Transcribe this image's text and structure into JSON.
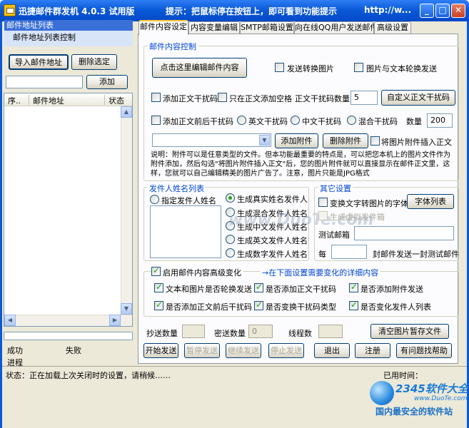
{
  "window": {
    "title": "迅捷邮件群发机 4.0.3 试用版",
    "hint": "提示：把鼠标停在按钮上，即可看到功能提示",
    "url": "http://w..."
  },
  "left": {
    "section_title": "邮件地址列表",
    "list_control": "邮件地址列表控制",
    "import_button": "导入邮件地址",
    "delete_button": "删除选定",
    "add_input_value": "",
    "add_button": "添加",
    "columns": [
      "序..",
      "邮件地址",
      "状态"
    ],
    "success_label": "成功",
    "fail_label": "失败",
    "progress_label": "进程"
  },
  "tabs": [
    {
      "label": "邮件内容设定",
      "active": true
    },
    {
      "label": "内容变量编辑"
    },
    {
      "label": "SMTP邮箱设置"
    },
    {
      "label": "向在线QQ用户发送邮件"
    },
    {
      "label": "高级设置"
    }
  ],
  "content": {
    "group_title": "邮件内容控制",
    "edit_button": "点击这里编辑邮件内容",
    "send_as_image": "发送转换图片",
    "image_text_rotate": "图片与文本轮换发送",
    "add_noise": "添加正文干扰码",
    "only_spaces": "只在正文添加空格",
    "noise_count_label": "正文干扰码数量",
    "noise_count_value": "5",
    "custom_noise_button": "自定义正文干扰码",
    "add_head_tail_noise": "添加正文前后干扰码",
    "radio_english": "英文干扰码",
    "radio_chinese": "中文干扰码",
    "radio_mixed": "混合干扰码",
    "count_label": "数量",
    "count_value": "200",
    "attachment_select": "",
    "add_attachment_button": "添加附件",
    "delete_attachment_button": "删除附件",
    "insert_image_attachment": "将图片附件插入正文",
    "note": "说明：附件可以是任意类型的文件。但本功能最重要的特点是，可以把您本机上的图片文件作为附件添加，然后勾选\"将图片附件插入正文\"后，您的图片附件就可以直接显示在邮件正文里，这样，您就可以自己编辑精美的图片广告了。注意，图片只能是JPG格式"
  },
  "sender": {
    "group_title": "发件人姓名列表",
    "specify": "指定发件人姓名",
    "real": "生成真实姓名发件人",
    "mixed": "生成混合发件人姓名",
    "chinese": "生成中文发件人姓名",
    "english": "生成英文发件人姓名",
    "digits": "生成数字发件人姓名"
  },
  "other": {
    "group_title": "其它设置",
    "text_to_image_font": "变换文字转图片的字体",
    "font_list_button": "字体列表",
    "fake_sender_box": "生成虚拟发件箱",
    "test_email_label": "测试邮箱",
    "test_email_value": "",
    "every_label": "每",
    "every_value": "",
    "every_suffix": "封邮件发送一封测试邮件"
  },
  "advanced": {
    "enable": "启用邮件内容高级变化",
    "hint": "→在下面设置需要变化的详细内容",
    "items": [
      "文本和图片是否轮换发送",
      "是否添加正文干扰码",
      "是否添加附件发送",
      "是否添加正文前后干扰码",
      "是否变换干扰码类型",
      "是否变化发件人列表"
    ]
  },
  "footer": {
    "cc_label": "抄送数量",
    "cc_value": "",
    "bcc_label": "密送数量",
    "bcc_value": "0",
    "threads_label": "线程数",
    "threads_value": "",
    "clear_cache_button": "清空图片暂存文件",
    "start_button": "开始发送",
    "pause_button": "暂停发送",
    "resume_button": "继续发送",
    "stop_button": "停止发送",
    "exit_button": "退出",
    "register_button": "注册",
    "help_button": "有问题找帮助",
    "status_text": "状态：正在加载上次关闭时的设置，请稍候……",
    "elapsed_label": "已用时间："
  },
  "watermark": {
    "brand": "2345软件大全",
    "site": "www.DuoTe.com",
    "slogan": "国内最安全的软件站",
    "overlay": "www.DuoTe.com"
  },
  "colors": {
    "titlebar": "#0a5ad8",
    "panel": "#ece9d8",
    "accent": "#0046d5"
  }
}
